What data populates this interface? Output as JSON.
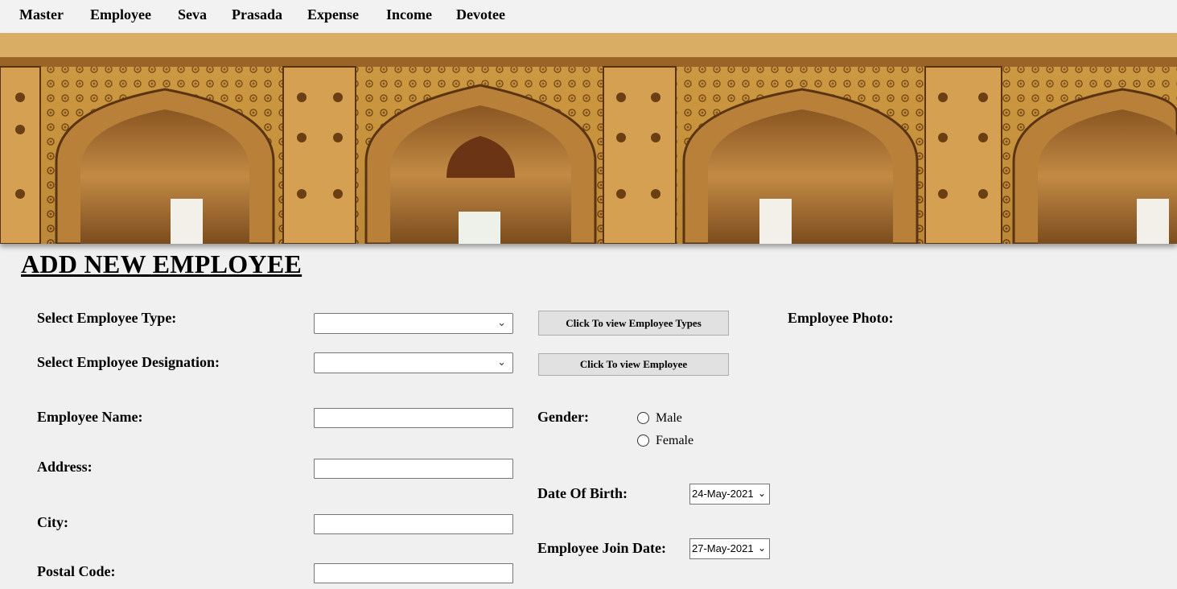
{
  "menu": {
    "items": [
      "Master",
      "Employee",
      "Seva",
      "Prasada",
      "Expense",
      "Income",
      "Devotee"
    ]
  },
  "page": {
    "title": "ADD NEW EMPLOYEE"
  },
  "form": {
    "employee_type_label": "Select Employee Type:",
    "employee_type_value": "",
    "designation_label": "Select Employee Designation:",
    "designation_value": "",
    "view_types_button": "Click To view Employee Types",
    "view_employee_button": "Click To view Employee",
    "photo_label": "Employee Photo:",
    "name_label": "Employee Name:",
    "address_label": "Address:",
    "city_label": "City:",
    "postal_label": "Postal Code:",
    "gender_label": "Gender:",
    "gender_options": [
      "Male",
      "Female"
    ],
    "dob_label": "Date Of Birth:",
    "dob_value": "24-May-2021",
    "join_label": "Employee Join Date:",
    "join_value": "27-May-2021"
  },
  "icons": {
    "dropdown": "chevron-down-icon"
  }
}
